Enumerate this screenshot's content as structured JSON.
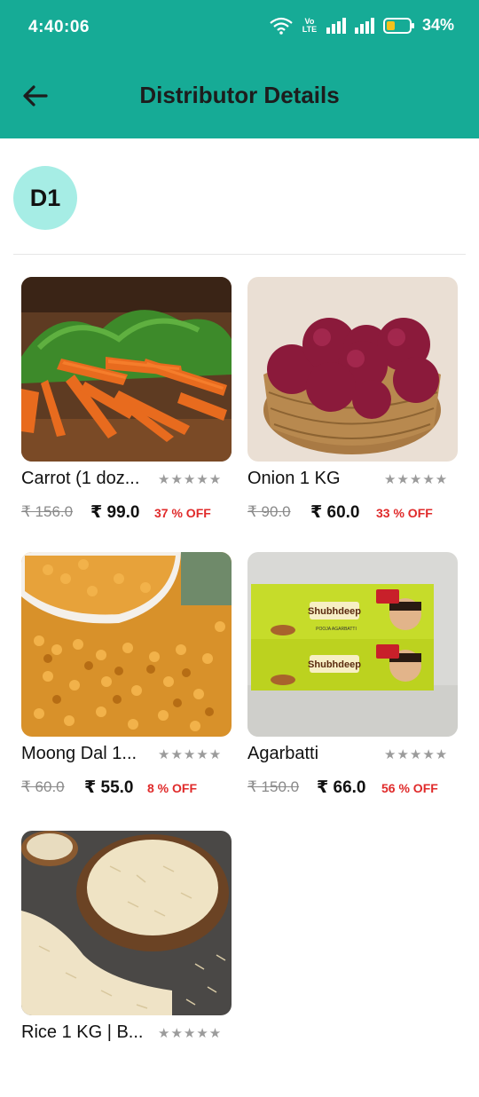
{
  "status_bar": {
    "time": "4:40:06",
    "network_label": "Vo LTE",
    "battery_percent": "34%"
  },
  "header": {
    "title": "Distributor Details"
  },
  "distributor": {
    "avatar_text": "D1"
  },
  "products": [
    {
      "name": "Carrot (1 doz...",
      "mrp": "₹ 156.0",
      "price": "₹ 99.0",
      "discount": "37 % OFF",
      "rating": "★★★★★",
      "image": "carrot-image"
    },
    {
      "name": "Onion 1 KG",
      "mrp": "₹ 90.0",
      "price": "₹ 60.0",
      "discount": "33 % OFF",
      "rating": "★★★★★",
      "image": "onion-image"
    },
    {
      "name": "Moong Dal 1...",
      "mrp": "₹ 60.0",
      "price": "₹ 55.0",
      "discount": "8 % OFF",
      "rating": "★★★★★",
      "image": "moong-dal-image"
    },
    {
      "name": "Agarbatti",
      "mrp": "₹ 150.0",
      "price": "₹ 66.0",
      "discount": "56 % OFF",
      "rating": "★★★★★",
      "image": "agarbatti-image",
      "brand_text": "Shubhdeep",
      "brand_text_2": "Shubhdeep",
      "sub_text": "POOJA AGARBATTI"
    },
    {
      "name": "Rice 1 KG | B...",
      "rating": "★★★★★",
      "image": "rice-image"
    }
  ],
  "colors": {
    "header_bg": "#16ab96",
    "avatar_bg": "#a6ede5",
    "discount": "#e02a2a"
  }
}
